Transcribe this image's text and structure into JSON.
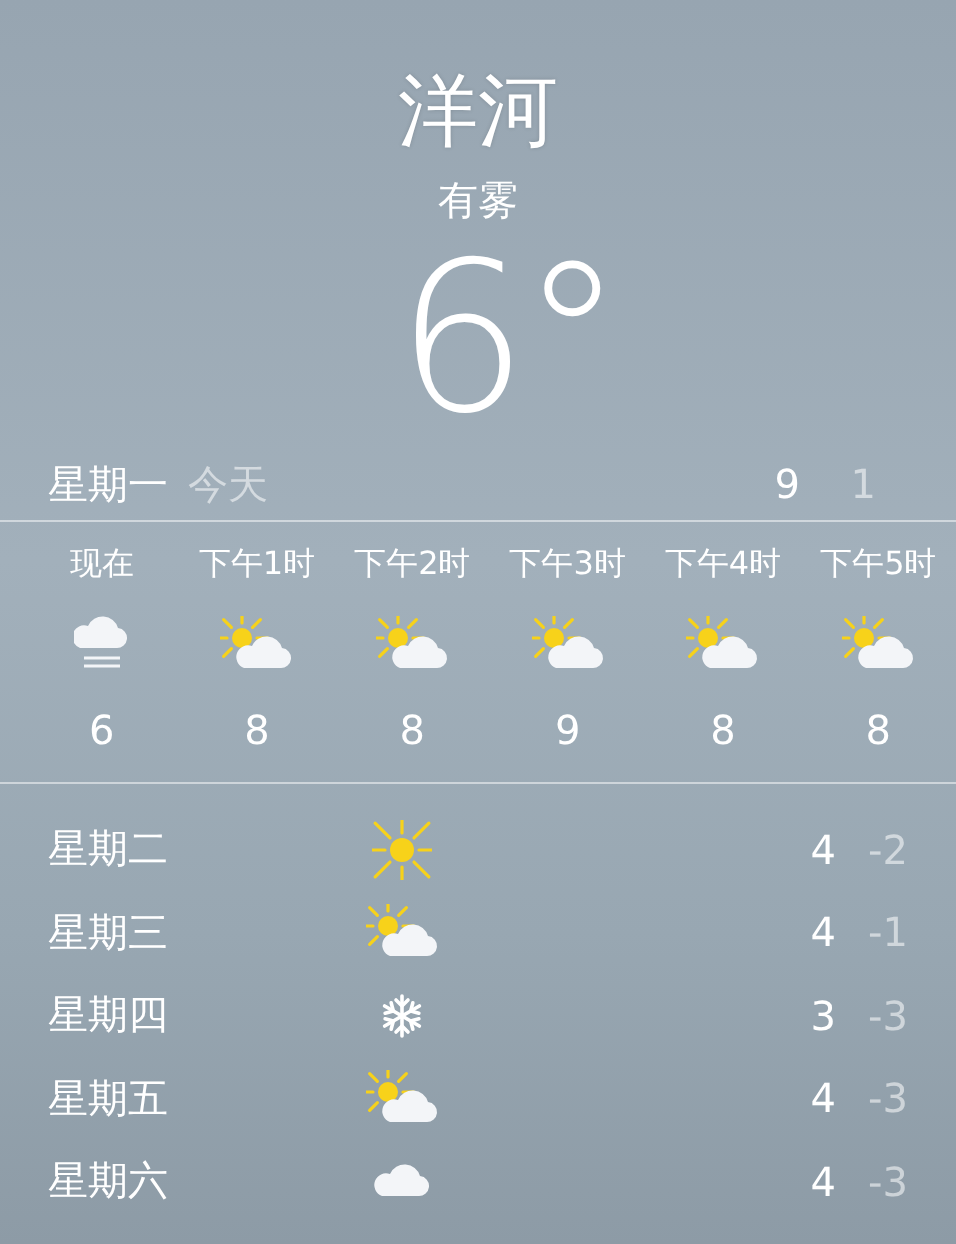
{
  "location": {
    "city": "洋河",
    "condition": "有雾",
    "temperature": "6°"
  },
  "today": {
    "day": "星期一",
    "label": "今天",
    "high": "9",
    "low": "1"
  },
  "hourly": [
    {
      "time": "现在",
      "kind": "fog",
      "temp": "6"
    },
    {
      "time": "下午1时",
      "kind": "partly_cloudy",
      "temp": "8"
    },
    {
      "time": "下午2时",
      "kind": "partly_cloudy",
      "temp": "8"
    },
    {
      "time": "下午3时",
      "kind": "partly_cloudy",
      "temp": "9"
    },
    {
      "time": "下午4时",
      "kind": "partly_cloudy",
      "temp": "8"
    },
    {
      "time": "下午5时",
      "kind": "partly_cloudy",
      "temp": "8"
    }
  ],
  "daily": [
    {
      "day": "星期二",
      "kind": "sunny",
      "high": "4",
      "low": "-2"
    },
    {
      "day": "星期三",
      "kind": "partly_cloudy",
      "high": "4",
      "low": "-1"
    },
    {
      "day": "星期四",
      "kind": "snow",
      "high": "3",
      "low": "-3"
    },
    {
      "day": "星期五",
      "kind": "partly_cloudy",
      "high": "4",
      "low": "-3"
    },
    {
      "day": "星期六",
      "kind": "cloudy",
      "high": "4",
      "low": "-3"
    }
  ]
}
